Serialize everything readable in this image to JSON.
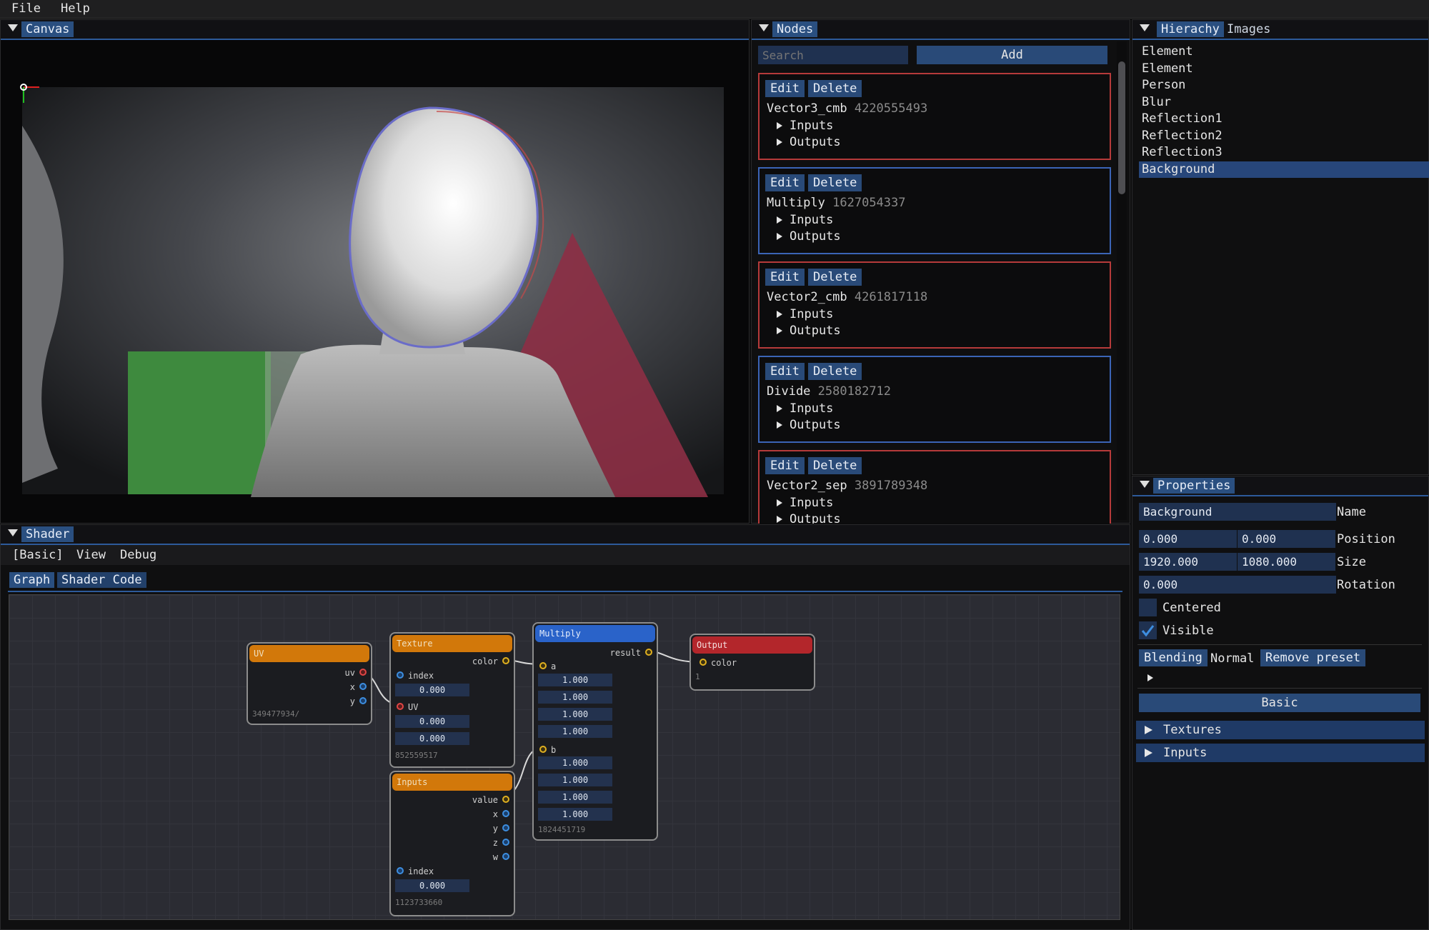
{
  "menu": {
    "file": "File",
    "help": "Help"
  },
  "canvas": {
    "tab": "Canvas"
  },
  "nodes_panel": {
    "tab": "Nodes",
    "search_placeholder": "Search",
    "add_label": "Add",
    "edit_label": "Edit",
    "delete_label": "Delete",
    "inputs_label": "Inputs",
    "outputs_label": "Outputs",
    "items": [
      {
        "name": "Vector3_cmb",
        "id": "4220555493"
      },
      {
        "name": "Multiply",
        "id": "1627054337"
      },
      {
        "name": "Vector2_cmb",
        "id": "4261817118"
      },
      {
        "name": "Divide",
        "id": "2580182712"
      },
      {
        "name": "Vector2_sep",
        "id": "3891789348"
      }
    ]
  },
  "hierarchy": {
    "tab_active": "Hierachy",
    "tab_other": "Images",
    "items": [
      "Element",
      "Element",
      "Person",
      "Blur",
      "Reflection1",
      "Reflection2",
      "Reflection3",
      "Background"
    ]
  },
  "properties": {
    "tab": "Properties",
    "name_value": "Background",
    "name_label": "Name",
    "pos_x": "0.000",
    "pos_y": "0.000",
    "position_label": "Position",
    "size_w": "1920.000",
    "size_h": "1080.000",
    "size_label": "Size",
    "rotation": "0.000",
    "rotation_label": "Rotation",
    "centered_label": "Centered",
    "visible_label": "Visible",
    "blending_label": "Blending",
    "blending_value": "Normal",
    "remove_preset_label": "Remove preset",
    "basic_label": "Basic",
    "textures_label": "Textures",
    "inputs_label": "Inputs"
  },
  "shader": {
    "tab": "Shader",
    "menu_basic": "[Basic]",
    "menu_view": "View",
    "menu_debug": "Debug",
    "tab_graph": "Graph",
    "tab_code": "Shader Code",
    "uv_node": {
      "title": "UV",
      "out_uv": "uv",
      "out_x": "x",
      "out_y": "y",
      "id": "349477934/"
    },
    "texture_node": {
      "title": "Texture",
      "out_color": "color",
      "in_index": "index",
      "index_val": "0.000",
      "in_uv": "UV",
      "uv_x": "0.000",
      "uv_y": "0.000",
      "id": "852559517"
    },
    "inputs_node": {
      "title": "Inputs",
      "out_value": "value",
      "out_x": "x",
      "out_y": "y",
      "out_z": "z",
      "out_w": "w",
      "in_index": "index",
      "index_val": "0.000",
      "id": "1123733660"
    },
    "multiply_node": {
      "title": "Multiply",
      "out_result": "result",
      "in_a": "a",
      "a_vals": [
        "1.000",
        "1.000",
        "1.000",
        "1.000"
      ],
      "in_b": "b",
      "b_vals": [
        "1.000",
        "1.000",
        "1.000",
        "1.000"
      ],
      "id": "1824451719"
    },
    "output_node": {
      "title": "Output",
      "in_color": "color",
      "id": "1"
    }
  },
  "colors": {
    "accent": "#2a4f80",
    "node_orange": "#d2780a",
    "node_blue": "#2a63c9",
    "node_red": "#b3262b",
    "card_red": "#b63a3a",
    "card_blue": "#3b64b6"
  }
}
